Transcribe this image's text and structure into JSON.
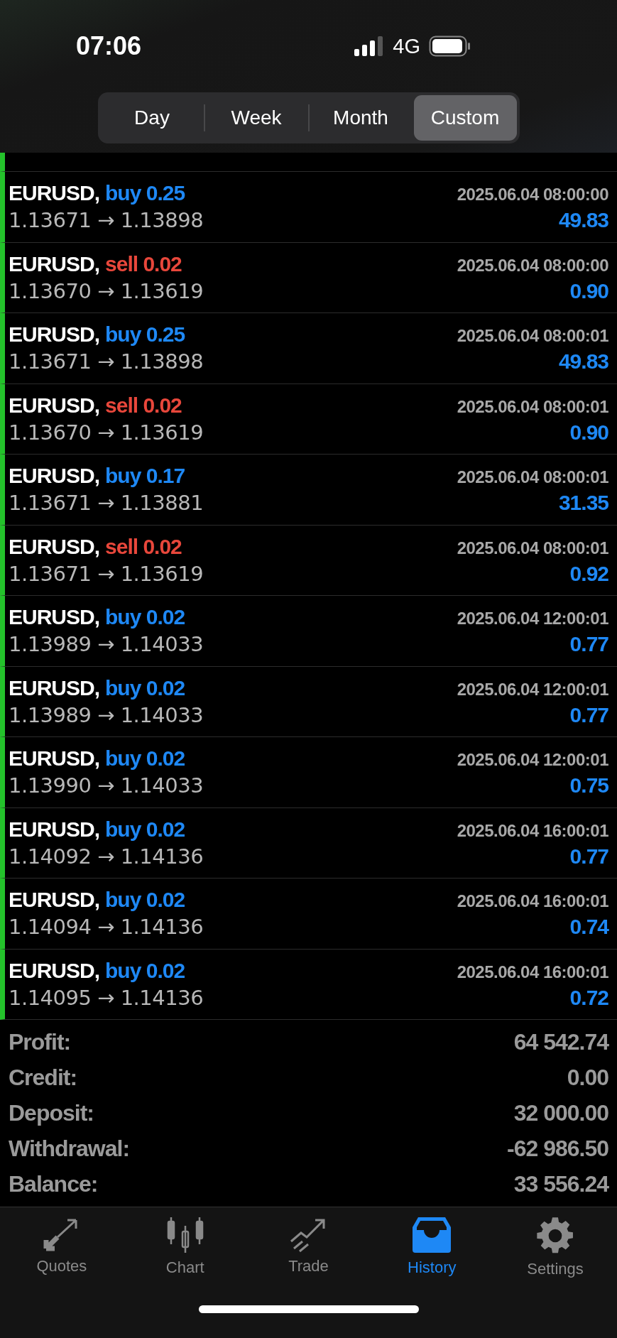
{
  "status_bar": {
    "time": "07:06",
    "network": "4G"
  },
  "period_tabs": [
    {
      "label": "Day",
      "selected": false
    },
    {
      "label": "Week",
      "selected": false
    },
    {
      "label": "Month",
      "selected": false
    },
    {
      "label": "Custom",
      "selected": true
    }
  ],
  "deals": [
    {
      "symbol": "EURUSD,",
      "side": "buy",
      "volume": "0.25",
      "time": "2025.06.04 08:00:00",
      "prices": "1.13671 → 1.13898",
      "profit": "49.83"
    },
    {
      "symbol": "EURUSD,",
      "side": "sell",
      "volume": "0.02",
      "time": "2025.06.04 08:00:00",
      "prices": "1.13670 → 1.13619",
      "profit": "0.90"
    },
    {
      "symbol": "EURUSD,",
      "side": "buy",
      "volume": "0.25",
      "time": "2025.06.04 08:00:01",
      "prices": "1.13671 → 1.13898",
      "profit": "49.83"
    },
    {
      "symbol": "EURUSD,",
      "side": "sell",
      "volume": "0.02",
      "time": "2025.06.04 08:00:01",
      "prices": "1.13670 → 1.13619",
      "profit": "0.90"
    },
    {
      "symbol": "EURUSD,",
      "side": "buy",
      "volume": "0.17",
      "time": "2025.06.04 08:00:01",
      "prices": "1.13671 → 1.13881",
      "profit": "31.35"
    },
    {
      "symbol": "EURUSD,",
      "side": "sell",
      "volume": "0.02",
      "time": "2025.06.04 08:00:01",
      "prices": "1.13671 → 1.13619",
      "profit": "0.92"
    },
    {
      "symbol": "EURUSD,",
      "side": "buy",
      "volume": "0.02",
      "time": "2025.06.04 12:00:01",
      "prices": "1.13989 → 1.14033",
      "profit": "0.77"
    },
    {
      "symbol": "EURUSD,",
      "side": "buy",
      "volume": "0.02",
      "time": "2025.06.04 12:00:01",
      "prices": "1.13989 → 1.14033",
      "profit": "0.77"
    },
    {
      "symbol": "EURUSD,",
      "side": "buy",
      "volume": "0.02",
      "time": "2025.06.04 12:00:01",
      "prices": "1.13990 → 1.14033",
      "profit": "0.75"
    },
    {
      "symbol": "EURUSD,",
      "side": "buy",
      "volume": "0.02",
      "time": "2025.06.04 16:00:01",
      "prices": "1.14092 → 1.14136",
      "profit": "0.77"
    },
    {
      "symbol": "EURUSD,",
      "side": "buy",
      "volume": "0.02",
      "time": "2025.06.04 16:00:01",
      "prices": "1.14094 → 1.14136",
      "profit": "0.74"
    },
    {
      "symbol": "EURUSD,",
      "side": "buy",
      "volume": "0.02",
      "time": "2025.06.04 16:00:01",
      "prices": "1.14095 → 1.14136",
      "profit": "0.72"
    }
  ],
  "summary": [
    {
      "label": "Profit:",
      "value": "64 542.74"
    },
    {
      "label": "Credit:",
      "value": "0.00"
    },
    {
      "label": "Deposit:",
      "value": "32 000.00"
    },
    {
      "label": "Withdrawal:",
      "value": "-62 986.50"
    },
    {
      "label": "Balance:",
      "value": "33 556.24"
    }
  ],
  "tab_bar": [
    {
      "kind": "quotes",
      "label": "Quotes",
      "selected": false
    },
    {
      "kind": "chart",
      "label": "Chart",
      "selected": false
    },
    {
      "kind": "trade",
      "label": "Trade",
      "selected": false
    },
    {
      "kind": "history",
      "label": "History",
      "selected": true
    },
    {
      "kind": "settings",
      "label": "Settings",
      "selected": false
    }
  ]
}
